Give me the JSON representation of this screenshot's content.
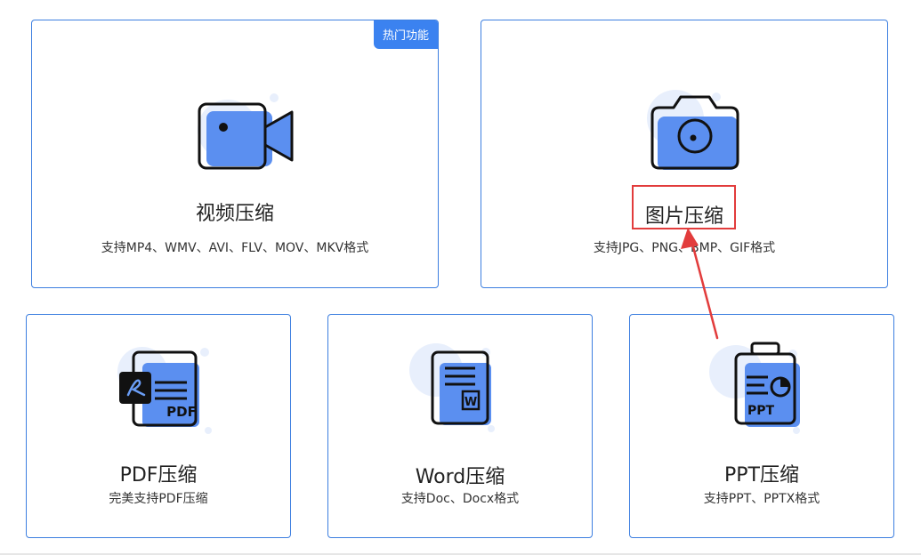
{
  "colors": {
    "accent": "#3d7fe0",
    "icon_fill": "#5b8ff0",
    "icon_bg": "#e8effc",
    "annotation": "#e23c3c"
  },
  "cards": [
    {
      "id": "video",
      "title": "视频压缩",
      "desc": "支持MP4、WMV、AVI、FLV、MOV、MKV格式",
      "badge": "热门功能",
      "icon": "video-camera-icon"
    },
    {
      "id": "image",
      "title": "图片压缩",
      "desc": "支持JPG、PNG、BMP、GIF格式",
      "icon": "camera-icon"
    },
    {
      "id": "pdf",
      "title": "PDF压缩",
      "desc": "完美支持PDF压缩",
      "icon": "pdf-document-icon",
      "icon_label": "PDF"
    },
    {
      "id": "word",
      "title": "Word压缩",
      "desc": "支持Doc、Docx格式",
      "icon": "word-document-icon",
      "icon_label": "W"
    },
    {
      "id": "ppt",
      "title": "PPT压缩",
      "desc": "支持PPT、PPTX格式",
      "icon": "ppt-clipboard-icon",
      "icon_label": "PPT"
    }
  ]
}
